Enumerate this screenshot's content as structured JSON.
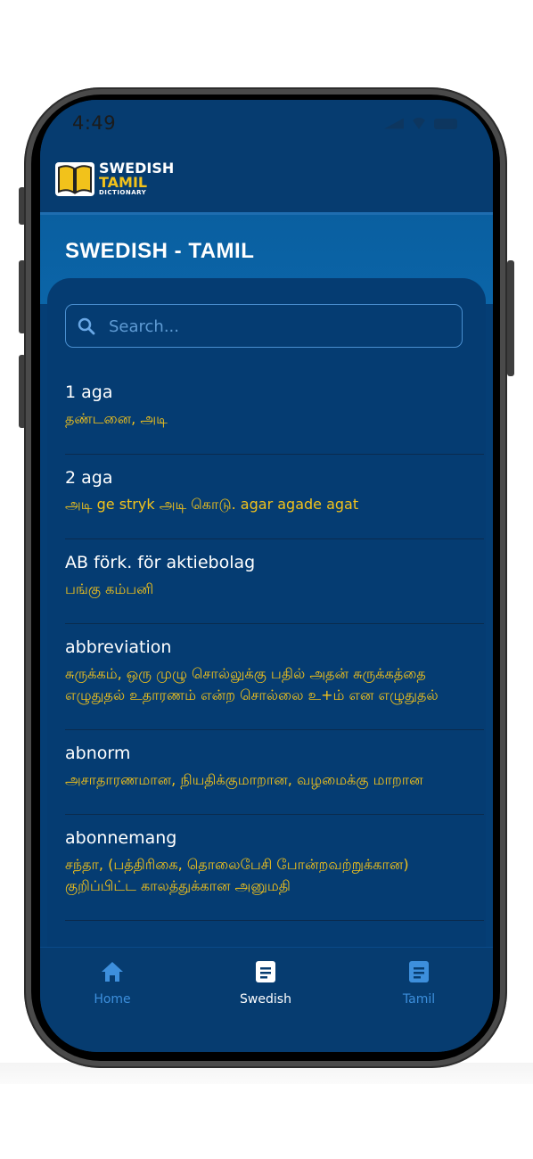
{
  "status_bar": {
    "time": "4:49"
  },
  "logo": {
    "line1": "SWEDISH",
    "line2": "TAMIL",
    "line3": "DICTIONARY"
  },
  "page": {
    "title": "SWEDISH - TAMIL"
  },
  "search": {
    "placeholder": "Search..."
  },
  "entries": [
    {
      "word": "1 aga",
      "meaning": "தண்டனை, அடி"
    },
    {
      "word": "2 aga",
      "meaning": "அடி ge stryk அடி கொடு. agar agade agat"
    },
    {
      "word": "AB förk. för aktiebolag",
      "meaning": "பங்கு கம்பனி"
    },
    {
      "word": "abbreviation",
      "meaning": "சுருக்கம், ஒரு முழு சொல்லுக்கு பதில் அதன் சுருக்கத்தை எழுதுதல் உதாரணம் என்ற சொல்லை உ+ம் என எழுதுதல்"
    },
    {
      "word": "abnorm",
      "meaning": "அசாதாரணமான, நியதிக்குமாறான, வழமைக்கு மாறான"
    },
    {
      "word": "abonnemang",
      "meaning": "சந்தா, (பத்திரிகை, தொலைபேசி போன்றவற்றுக்கான) குறிப்பிட்ட காலத்துக்கான அனுமதி"
    }
  ],
  "bottom_nav": [
    {
      "label": "Home",
      "icon": "home-icon",
      "active": false
    },
    {
      "label": "Swedish",
      "icon": "document-icon",
      "active": true
    },
    {
      "label": "Tamil",
      "icon": "document-icon",
      "active": false
    }
  ],
  "colors": {
    "accent_yellow": "#f2c21b",
    "header_blue": "#063c70",
    "band_blue": "#0b65a8"
  }
}
